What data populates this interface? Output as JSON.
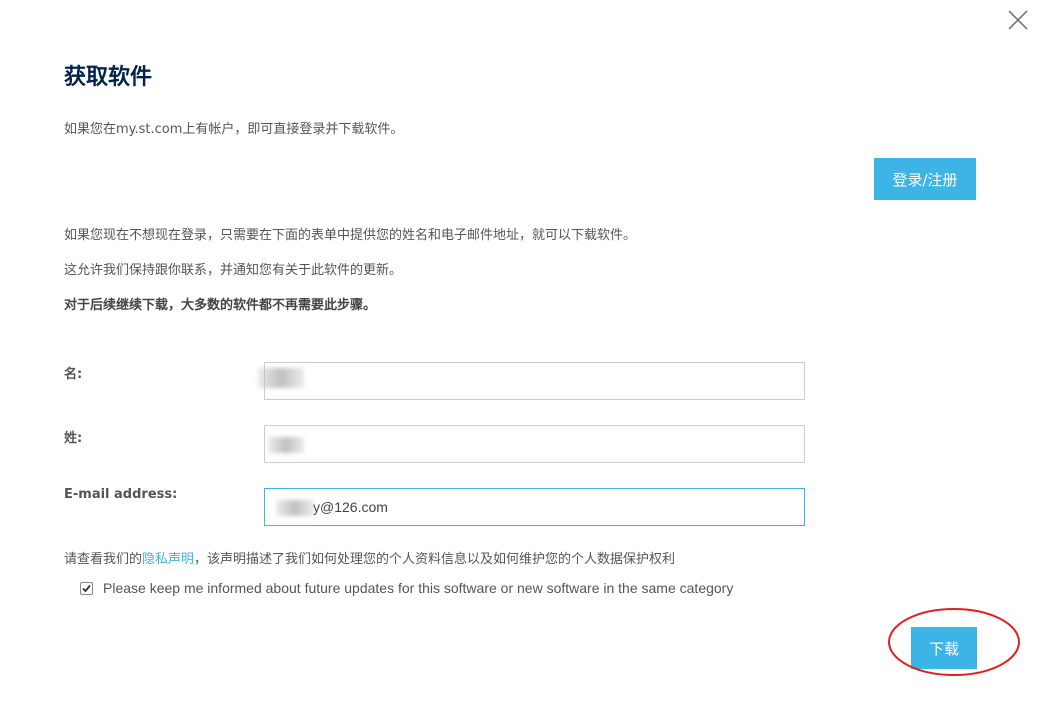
{
  "dialog": {
    "title": "获取软件",
    "intro_text": "如果您在my.st.com上有帐户，即可直接登录并下载软件。",
    "login_button_label": "登录/注册",
    "info_text_1": "如果您现在不想现在登录，只需要在下面的表单中提供您的姓名和电子邮件地址，就可以下载软件。",
    "info_text_2": "这允许我们保持跟你联系，并通知您有关于此软件的更新。",
    "info_text_bold": "对于后续继续下载，大多数的软件都不再需要此步骤。"
  },
  "form": {
    "first_name": {
      "label": "名:",
      "value": ""
    },
    "last_name": {
      "label": "姓:",
      "value": ""
    },
    "email": {
      "label": "E-mail address:",
      "value": "y@126.com"
    }
  },
  "privacy": {
    "prefix": "请查看我们的",
    "link_text": "隐私声明",
    "suffix": "，该声明描述了我们如何处理您的个人资料信息以及如何维护您的个人数据保护权利"
  },
  "newsletter": {
    "checked": true,
    "label": "Please keep me informed about future updates for this software or new software in the same category"
  },
  "download_button_label": "下载",
  "colors": {
    "accent": "#3cb4e6",
    "title": "#03234b",
    "annotation": "#e02020"
  }
}
